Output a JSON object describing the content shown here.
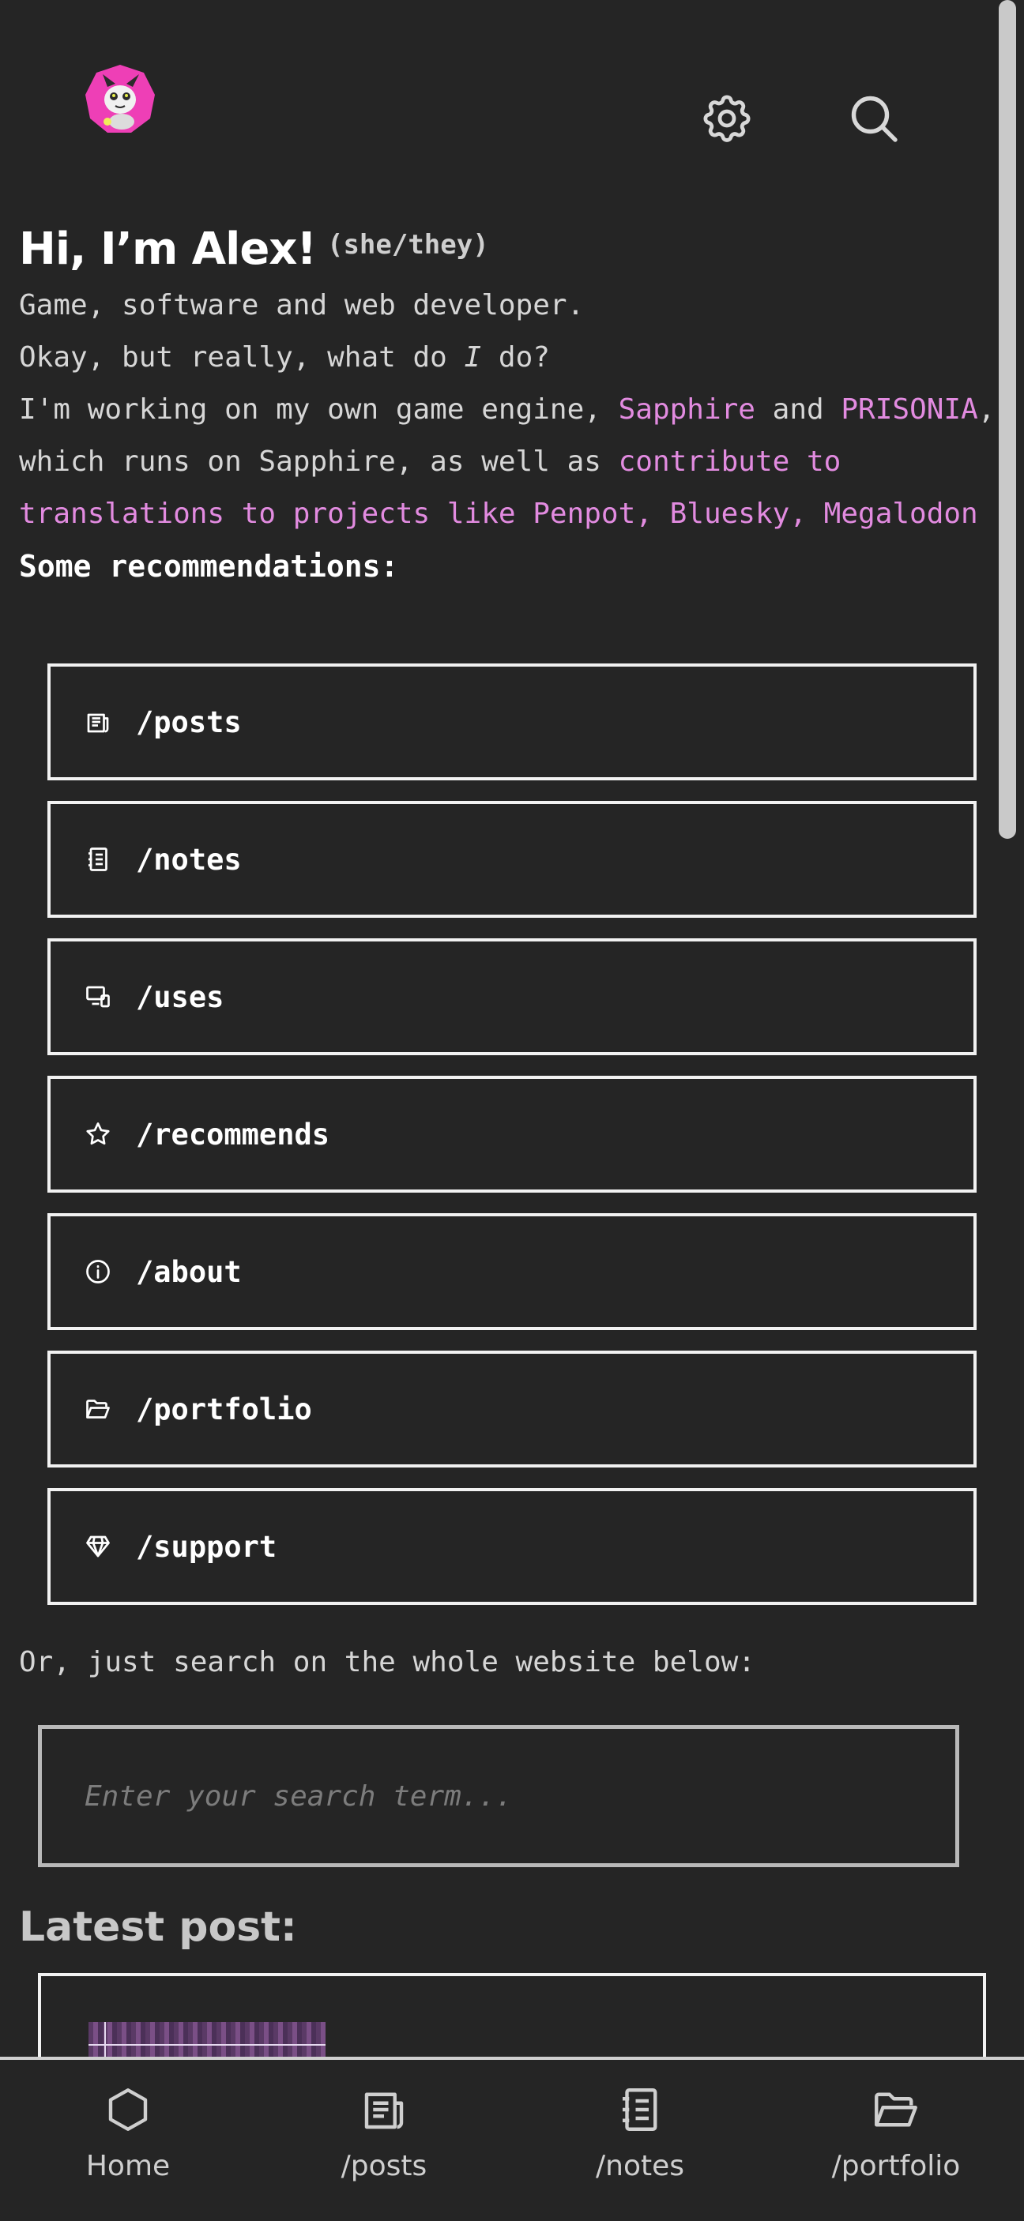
{
  "header": {
    "avatar_icon": "cat-mascot-avatar",
    "settings_icon": "gear-icon",
    "search_icon": "search-icon"
  },
  "intro": {
    "title": "Hi, I’m Alex!",
    "pronouns": "(she/they)",
    "line1": "Game, software and web developer.",
    "line2_pre": "Okay, but really, what do ",
    "line2_em": "I",
    "line2_post": " do?",
    "line3_pre": "I'm working on my own game engine, ",
    "sapphire": "Sapphire",
    "and": " and",
    "prisonia": "PRISONIA",
    "line3_mid": ", which runs on Sapphire, as well as ",
    "contribute": "contribute to translations to projects like Penpot, Bluesky, Megalodon",
    "reco_heading": "Some recommendations:"
  },
  "recommendations": [
    {
      "label": "/posts",
      "icon": "newspaper-icon"
    },
    {
      "label": "/notes",
      "icon": "notebook-icon"
    },
    {
      "label": "/uses",
      "icon": "devices-icon"
    },
    {
      "label": "/recommends",
      "icon": "star-icon"
    },
    {
      "label": "/about",
      "icon": "info-icon"
    },
    {
      "label": "/portfolio",
      "icon": "folder-open-icon"
    },
    {
      "label": "/support",
      "icon": "diamond-icon"
    }
  ],
  "search": {
    "prompt": "Or, just search on the whole website below:",
    "placeholder": "Enter your search term..."
  },
  "latest": {
    "heading": "Latest post:"
  },
  "bottom_nav": [
    {
      "label": "Home",
      "icon": "hexagon-icon"
    },
    {
      "label": "/posts",
      "icon": "newspaper-icon"
    },
    {
      "label": "/notes",
      "icon": "notebook-icon"
    },
    {
      "label": "/portfolio",
      "icon": "folder-open-icon"
    }
  ],
  "colors": {
    "background": "#252525",
    "accent_link": "#e28be0",
    "border": "#f2f2f2"
  }
}
